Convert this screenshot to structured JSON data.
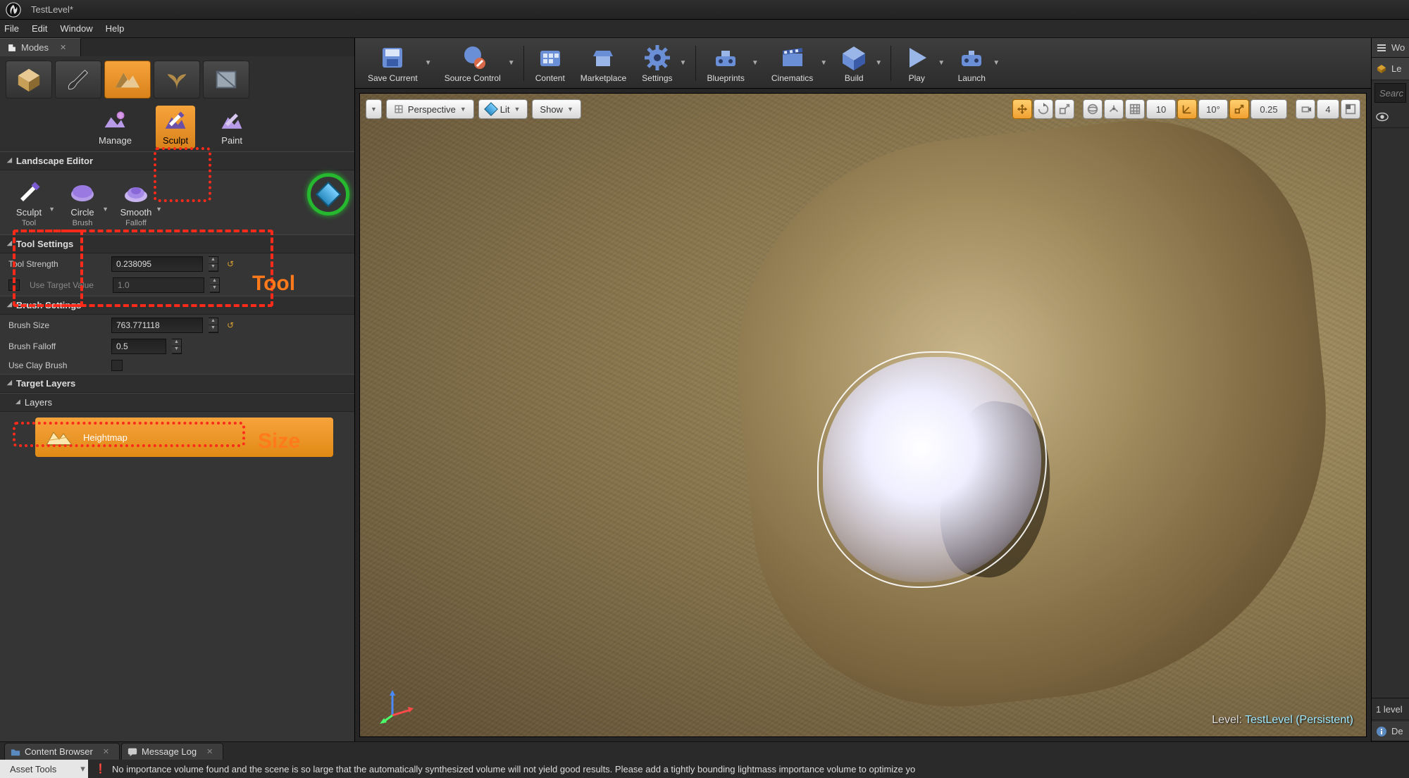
{
  "titlebar": {
    "title": "TestLevel*"
  },
  "menubar": [
    "File",
    "Edit",
    "Window",
    "Help"
  ],
  "modes_panel": {
    "tab_label": "Modes",
    "landscape_tabs": {
      "manage": "Manage",
      "sculpt": "Sculpt",
      "paint": "Paint"
    },
    "sections": {
      "landscape_editor": "Landscape Editor",
      "tool_settings": "Tool Settings",
      "brush_settings": "Brush Settings",
      "target_layers": "Target Layers",
      "layers": "Layers"
    },
    "tools": {
      "sculpt": {
        "label": "Sculpt",
        "sub": "Tool"
      },
      "circle": {
        "label": "Circle",
        "sub": "Brush"
      },
      "smooth": {
        "label": "Smooth",
        "sub": "Falloff"
      }
    },
    "tool_settings": {
      "tool_strength": {
        "label": "Tool Strength",
        "value": "0.238095"
      },
      "use_target_value": {
        "label": "Use Target Value",
        "value": "1.0"
      }
    },
    "brush_settings": {
      "brush_size": {
        "label": "Brush Size",
        "value": "763.771118"
      },
      "brush_falloff": {
        "label": "Brush Falloff",
        "value": "0.5"
      },
      "use_clay_brush": {
        "label": "Use Clay Brush"
      }
    },
    "target_layer_item": "Heightmap"
  },
  "annotations": {
    "tool": "Tool",
    "size": "Size"
  },
  "toolbar": {
    "save_current": "Save Current",
    "source_control": "Source Control",
    "content": "Content",
    "marketplace": "Marketplace",
    "settings": "Settings",
    "blueprints": "Blueprints",
    "cinematics": "Cinematics",
    "build": "Build",
    "play": "Play",
    "launch": "Launch"
  },
  "viewport": {
    "menu_perspective": "Perspective",
    "menu_lit": "Lit",
    "menu_show": "Show",
    "snap_grid": "10",
    "snap_angle": "10°",
    "snap_scale": "0.25",
    "cam_speed": "4",
    "level_label_prefix": "Level: ",
    "level_label": "TestLevel (Persistent)"
  },
  "right_panel": {
    "world_outliner_tab": "Wo",
    "level_header": "Le",
    "search_placeholder": "Searc",
    "eye_row": "",
    "count_row": "1 level",
    "details_tab": "De"
  },
  "bottom_tabs": {
    "content_browser": "Content Browser",
    "message_log": "Message Log"
  },
  "status": {
    "asset_tools": "Asset Tools",
    "warning": "No importance volume found and the scene is so large that the automatically synthesized volume will not yield good results.  Please add a tightly bounding lightmass importance volume to optimize yo"
  }
}
